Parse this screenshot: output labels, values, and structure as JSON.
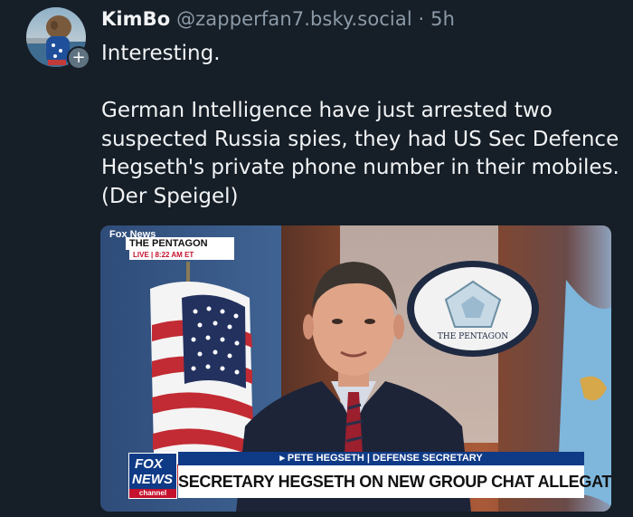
{
  "post": {
    "display_name": "KimBo",
    "handle": "@zapperfan7.bsky.social",
    "separator": "·",
    "time": "5h",
    "follow_symbol": "+",
    "text_line1": "Interesting.",
    "text_paragraph2": "German Intelligence have just arrested two suspected Russia spies, they had US Sec Defence Hegseth's private phone number in their mobiles. (Der Speigel)"
  },
  "embed": {
    "watermark": "Fox News",
    "location_title": "THE PENTAGON",
    "live_line": "LIVE  |  8:22 AM ET",
    "fox_logo_top": "FOX",
    "fox_logo_mid": "NEWS",
    "fox_logo_bottom": "channel",
    "seal_text": "THE PENTAGON",
    "lower_third_name": "▸ PETE HEGSETH  |  DEFENSE SECRETARY",
    "lower_third_headline": "SECRETARY HEGSETH ON NEW GROUP CHAT ALLEGATIONS"
  },
  "colors": {
    "background": "#161e27",
    "text": "#f1f3f5",
    "muted": "#8c9aa8",
    "fox_blue": "#0f3a86",
    "fox_red": "#c4122e"
  }
}
